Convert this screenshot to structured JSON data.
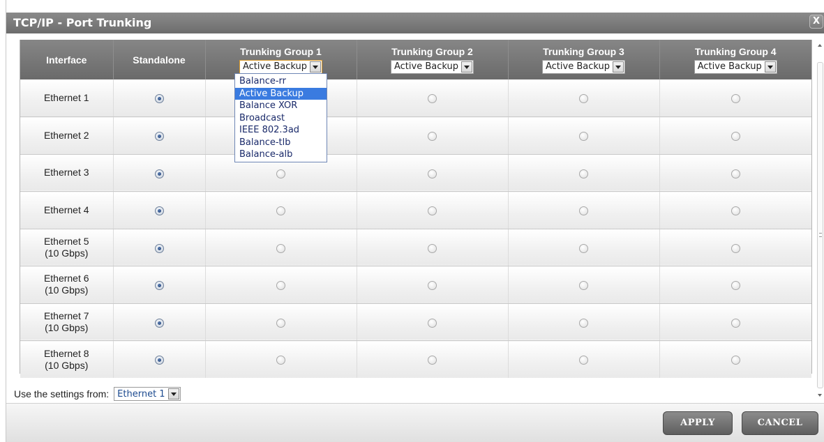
{
  "dialog": {
    "title": "TCP/IP - Port Trunking",
    "close_label": "X"
  },
  "table": {
    "headers": {
      "interface": "Interface",
      "standalone": "Standalone",
      "groups": [
        {
          "title": "Trunking Group 1",
          "mode": "Active Backup"
        },
        {
          "title": "Trunking Group 2",
          "mode": "Active Backup"
        },
        {
          "title": "Trunking Group 3",
          "mode": "Active Backup"
        },
        {
          "title": "Trunking Group 4",
          "mode": "Active Backup"
        }
      ]
    },
    "rows": [
      {
        "line1": "Ethernet 1",
        "line2": "",
        "selected": "Standalone"
      },
      {
        "line1": "Ethernet 2",
        "line2": "",
        "selected": "Standalone"
      },
      {
        "line1": "Ethernet 3",
        "line2": "",
        "selected": "Standalone"
      },
      {
        "line1": "Ethernet 4",
        "line2": "",
        "selected": "Standalone"
      },
      {
        "line1": "Ethernet 5",
        "line2": "(10 Gbps)",
        "selected": "Standalone"
      },
      {
        "line1": "Ethernet 6",
        "line2": "(10 Gbps)",
        "selected": "Standalone"
      },
      {
        "line1": "Ethernet 7",
        "line2": "(10 Gbps)",
        "selected": "Standalone"
      },
      {
        "line1": "Ethernet 8",
        "line2": "(10 Gbps)",
        "selected": "Standalone"
      }
    ]
  },
  "mode_dropdown": {
    "options": [
      "Balance-rr",
      "Active Backup",
      "Balance XOR",
      "Broadcast",
      "IEEE 802.3ad",
      "Balance-tlb",
      "Balance-alb"
    ],
    "highlighted": "Active Backup"
  },
  "settings_from": {
    "label": "Use the settings from:",
    "value": "Ethernet 1"
  },
  "buttons": {
    "apply": "APPLY",
    "cancel": "CANCEL"
  },
  "colors": {
    "header_bg": "#7a7a7a",
    "selection_highlight": "#3a7be0",
    "focus_border": "#d99a2b"
  }
}
